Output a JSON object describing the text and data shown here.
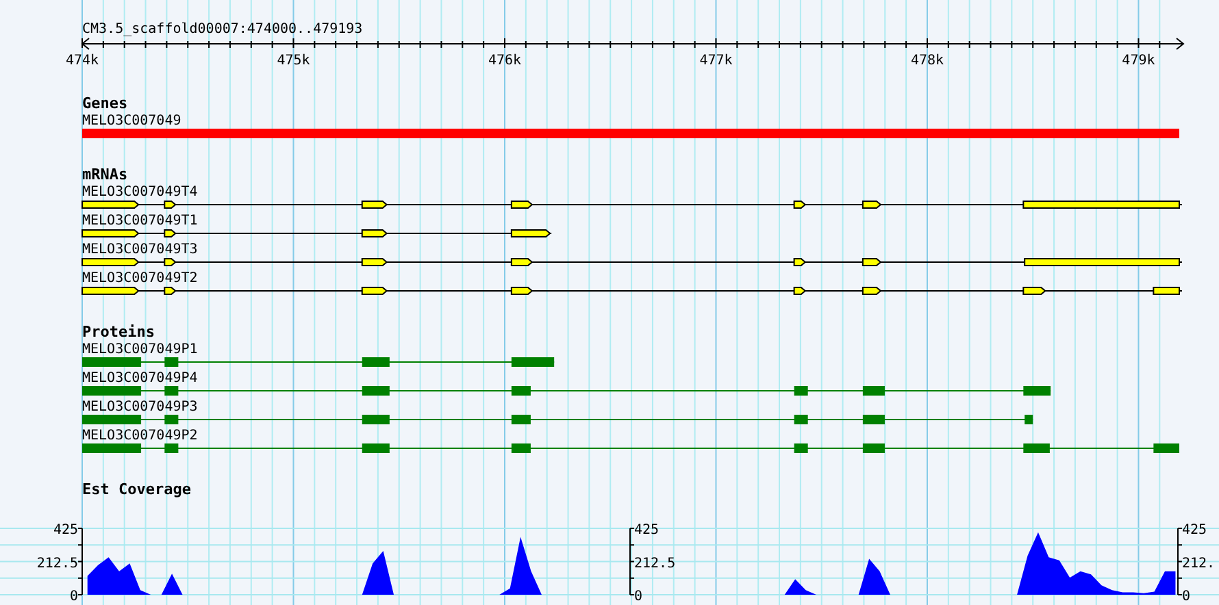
{
  "scale": {
    "title": "CM3.5_scaffold00007:474000..479193",
    "ticks": [
      "474k",
      "475k",
      "476k",
      "477k",
      "478k",
      "479k"
    ]
  },
  "tracks": [
    {
      "kind": "genes",
      "title": "Genes",
      "features": [
        {
          "name": "MELO3C007049"
        }
      ]
    },
    {
      "kind": "mrna",
      "title": "mRNAs",
      "features": [
        {
          "name": "MELO3C007049T4"
        },
        {
          "name": "MELO3C007049T1"
        },
        {
          "name": "MELO3C007049T3"
        },
        {
          "name": "MELO3C007049T2"
        }
      ]
    },
    {
      "kind": "protein",
      "title": "Proteins",
      "features": [
        {
          "name": "MELO3C007049P1"
        },
        {
          "name": "MELO3C007049P4"
        },
        {
          "name": "MELO3C007049P3"
        },
        {
          "name": "MELO3C007049P2"
        }
      ]
    },
    {
      "kind": "coverage",
      "title": "Est Coverage",
      "extra_axes": [
        {
          "labels": [
            "425",
            "212.5",
            "0"
          ]
        },
        {
          "labels": [
            "425",
            "212.",
            "0"
          ]
        }
      ],
      "chart_data": {
        "type": "area",
        "ylim": [
          0,
          425
        ],
        "yticks": [
          {
            "value": 0,
            "label": "0"
          },
          {
            "value": 212.5,
            "label": "212.5"
          },
          {
            "value": 425,
            "label": "425"
          }
        ],
        "categories": [
          null,
          null,
          null,
          null,
          null,
          null,
          null,
          null,
          null,
          null,
          null,
          null,
          null,
          null,
          null,
          null,
          null,
          null,
          null,
          null,
          null,
          null,
          null,
          null,
          null,
          null,
          null,
          null,
          null,
          null,
          null,
          null,
          null,
          null,
          null,
          null,
          null,
          null,
          null,
          null,
          null,
          null,
          null,
          null,
          null,
          null,
          null,
          null,
          null,
          null,
          null,
          null,
          null,
          null,
          null,
          null,
          null,
          null,
          null,
          null,
          null,
          null,
          null,
          null,
          null,
          null,
          null,
          null,
          null,
          null,
          null,
          null,
          null,
          null,
          null,
          null,
          null,
          null,
          null,
          null,
          null,
          null,
          null,
          null,
          null,
          null,
          null,
          null,
          null,
          null,
          null,
          null,
          null,
          null,
          null,
          null,
          null,
          null,
          null,
          null,
          null,
          null,
          null,
          null
        ],
        "series": [
          {
            "color": "#0000ff",
            "values": [
              120,
              190,
              240,
              150,
              200,
              30,
              0,
              0,
              135,
              0,
              0,
              0,
              0,
              0,
              0,
              0,
              0,
              0,
              0,
              0,
              0,
              0,
              0,
              0,
              0,
              0,
              0,
              200,
              280,
              0,
              0,
              0,
              0,
              0,
              0,
              0,
              0,
              0,
              0,
              0,
              40,
              370,
              150,
              0,
              0,
              0,
              0,
              0,
              0,
              0,
              0,
              0,
              0,
              0,
              0,
              0,
              0,
              0,
              0,
              0,
              0,
              0,
              0,
              0,
              0,
              0,
              0,
              100,
              30,
              0,
              0,
              0,
              0,
              0,
              230,
              150,
              0,
              0,
              0,
              0,
              0,
              0,
              0,
              0,
              0,
              0,
              0,
              0,
              0,
              250,
              400,
              240,
              220,
              110,
              150,
              130,
              60,
              30,
              15,
              15,
              10,
              20,
              150,
              150
            ]
          }
        ]
      }
    }
  ]
}
